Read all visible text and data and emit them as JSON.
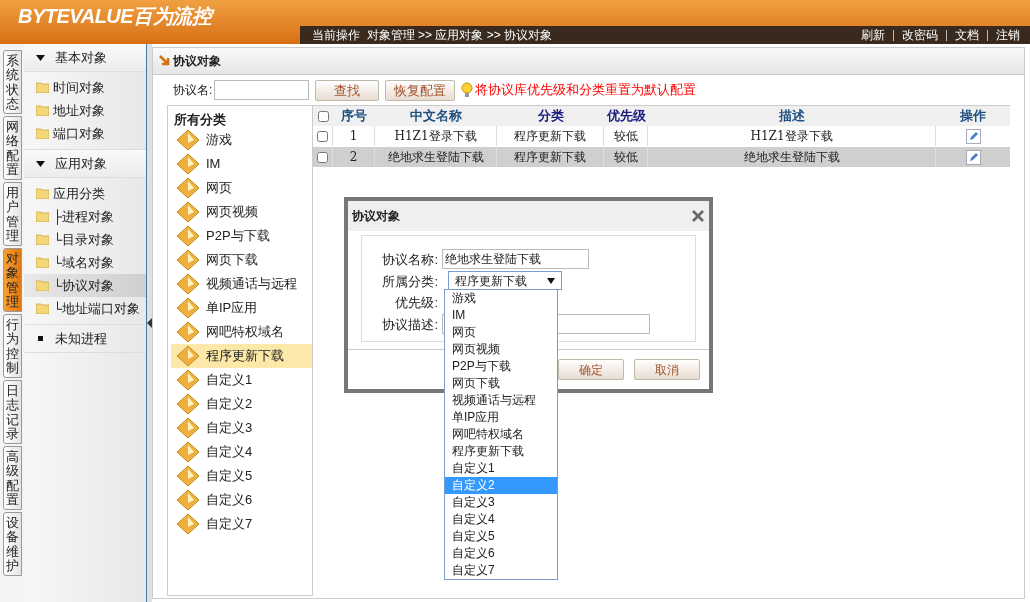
{
  "header": {
    "logo": "BYTEVALUE百为流控",
    "breadcrumb": "当前操作  对象管理 >> 应用对象 >> 协议对象",
    "links": [
      "刷新",
      "改密码",
      "文档",
      "注销"
    ]
  },
  "nav_tabs": [
    {
      "label": "系统状态",
      "selected": false
    },
    {
      "label": "网络配置",
      "selected": false
    },
    {
      "label": "用户管理",
      "selected": false
    },
    {
      "label": "对象管理",
      "selected": true
    },
    {
      "label": "行为控制",
      "selected": false
    },
    {
      "label": "日志记录",
      "selected": false
    },
    {
      "label": "高级配置",
      "selected": false
    },
    {
      "label": "设备维护",
      "selected": false
    }
  ],
  "sidebar": {
    "items": [
      {
        "kind": "group",
        "label": "基本对象",
        "expanded": true,
        "children": [
          {
            "kind": "folder",
            "label": "时间对象",
            "selected": false
          },
          {
            "kind": "folder",
            "label": "地址对象",
            "selected": false
          },
          {
            "kind": "folder",
            "label": "端口对象",
            "selected": false
          }
        ]
      },
      {
        "kind": "group",
        "label": "应用对象",
        "expanded": true,
        "children": [
          {
            "kind": "folder",
            "label": "应用分类",
            "selected": false
          },
          {
            "kind": "folder",
            "label": "├进程对象",
            "selected": false
          },
          {
            "kind": "folder",
            "label": "└目录对象",
            "selected": false
          },
          {
            "kind": "folder",
            "label": "└域名对象",
            "selected": false
          },
          {
            "kind": "folder",
            "label": "└协议对象",
            "selected": true
          },
          {
            "kind": "folder",
            "label": "└地址端口对象",
            "selected": false
          }
        ]
      },
      {
        "kind": "leaf",
        "label": "未知进程"
      }
    ]
  },
  "panel": {
    "title": "协议对象",
    "search_label": "协议名:",
    "buttons": [
      "查找",
      "恢复配置"
    ],
    "hint": "将协议库优先级和分类重置为默认配置"
  },
  "categories": {
    "title": "所有分类",
    "items": [
      {
        "label": "游戏",
        "selected": false
      },
      {
        "label": "IM",
        "selected": false
      },
      {
        "label": "网页",
        "selected": false
      },
      {
        "label": "网页视频",
        "selected": false
      },
      {
        "label": "P2P与下载",
        "selected": false
      },
      {
        "label": "网页下载",
        "selected": false
      },
      {
        "label": "视频通话与远程",
        "selected": false
      },
      {
        "label": "单IP应用",
        "selected": false
      },
      {
        "label": "网吧特权域名",
        "selected": false
      },
      {
        "label": "程序更新下载",
        "selected": true
      },
      {
        "label": "自定义1",
        "selected": false
      },
      {
        "label": "自定义2",
        "selected": false
      },
      {
        "label": "自定义3",
        "selected": false
      },
      {
        "label": "自定义4",
        "selected": false
      },
      {
        "label": "自定义5",
        "selected": false
      },
      {
        "label": "自定义6",
        "selected": false
      },
      {
        "label": "自定义7",
        "selected": false
      }
    ]
  },
  "table": {
    "select_all_checked": false,
    "columns": [
      "序号",
      "中文名称",
      "分类",
      "优先级",
      "描述",
      "操作"
    ],
    "rows": [
      {
        "cells": [
          "1",
          "H1Z1登录下载",
          "程序更新下载",
          "较低",
          "H1Z1登录下载"
        ],
        "checked": false,
        "selected": false
      },
      {
        "cells": [
          "2",
          "绝地求生登陆下载",
          "程序更新下载",
          "较低",
          "绝地求生登陆下载"
        ],
        "checked": false,
        "selected": true
      }
    ]
  },
  "dialog": {
    "title": "协议对象",
    "name_label": "协议名称:",
    "name_value": "绝地求生登陆下载",
    "category_label": "所属分类:",
    "category_value": "程序更新下载",
    "priority_label": "优先级:",
    "description_label": "协议描述:",
    "buttons": [
      "确定",
      "取消"
    ],
    "dropdown": [
      {
        "label": "游戏",
        "selected": false
      },
      {
        "label": "IM",
        "selected": false
      },
      {
        "label": "网页",
        "selected": false
      },
      {
        "label": "网页视频",
        "selected": false
      },
      {
        "label": "P2P与下载",
        "selected": false
      },
      {
        "label": "网页下载",
        "selected": false
      },
      {
        "label": "视频通话与远程",
        "selected": false
      },
      {
        "label": "单IP应用",
        "selected": false
      },
      {
        "label": "网吧特权域名",
        "selected": false
      },
      {
        "label": "程序更新下载",
        "selected": false
      },
      {
        "label": "自定义1",
        "selected": false
      },
      {
        "label": "自定义2",
        "selected": true
      },
      {
        "label": "自定义3",
        "selected": false
      },
      {
        "label": "自定义4",
        "selected": false
      },
      {
        "label": "自定义5",
        "selected": false
      },
      {
        "label": "自定义6",
        "selected": false
      },
      {
        "label": "自定义7",
        "selected": false
      }
    ]
  }
}
